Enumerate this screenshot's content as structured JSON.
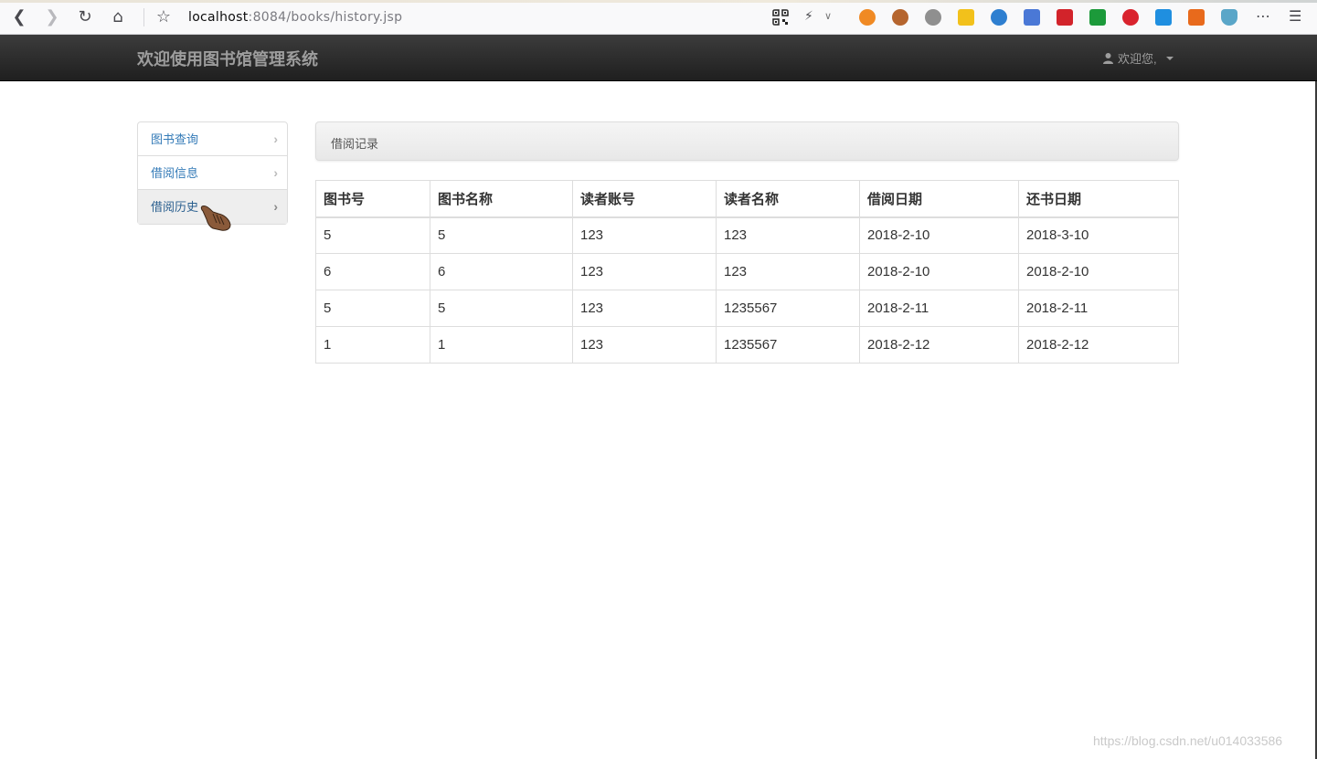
{
  "browser": {
    "url_host": "localhost",
    "url_rest": ":8084/books/history.jsp"
  },
  "navbar": {
    "brand": "欢迎使用图书馆管理系统",
    "user_label": "欢迎您,"
  },
  "sidebar": {
    "items": [
      {
        "label": "图书查询"
      },
      {
        "label": "借阅信息"
      },
      {
        "label": "借阅历史"
      }
    ]
  },
  "panel": {
    "title": "借阅记录"
  },
  "table": {
    "headers": [
      "图书号",
      "图书名称",
      "读者账号",
      "读者名称",
      "借阅日期",
      "还书日期"
    ],
    "rows": [
      [
        "5",
        "5",
        "123",
        "123",
        "2018-2-10",
        "2018-3-10"
      ],
      [
        "6",
        "6",
        "123",
        "123",
        "2018-2-10",
        "2018-2-10"
      ],
      [
        "5",
        "5",
        "123",
        "1235567",
        "2018-2-11",
        "2018-2-11"
      ],
      [
        "1",
        "1",
        "123",
        "1235567",
        "2018-2-12",
        "2018-2-12"
      ]
    ]
  },
  "watermark": "https://blog.csdn.net/u014033586",
  "colors": {
    "navbar_bg": "#222222",
    "link": "#337ab7",
    "border": "#dddddd"
  }
}
